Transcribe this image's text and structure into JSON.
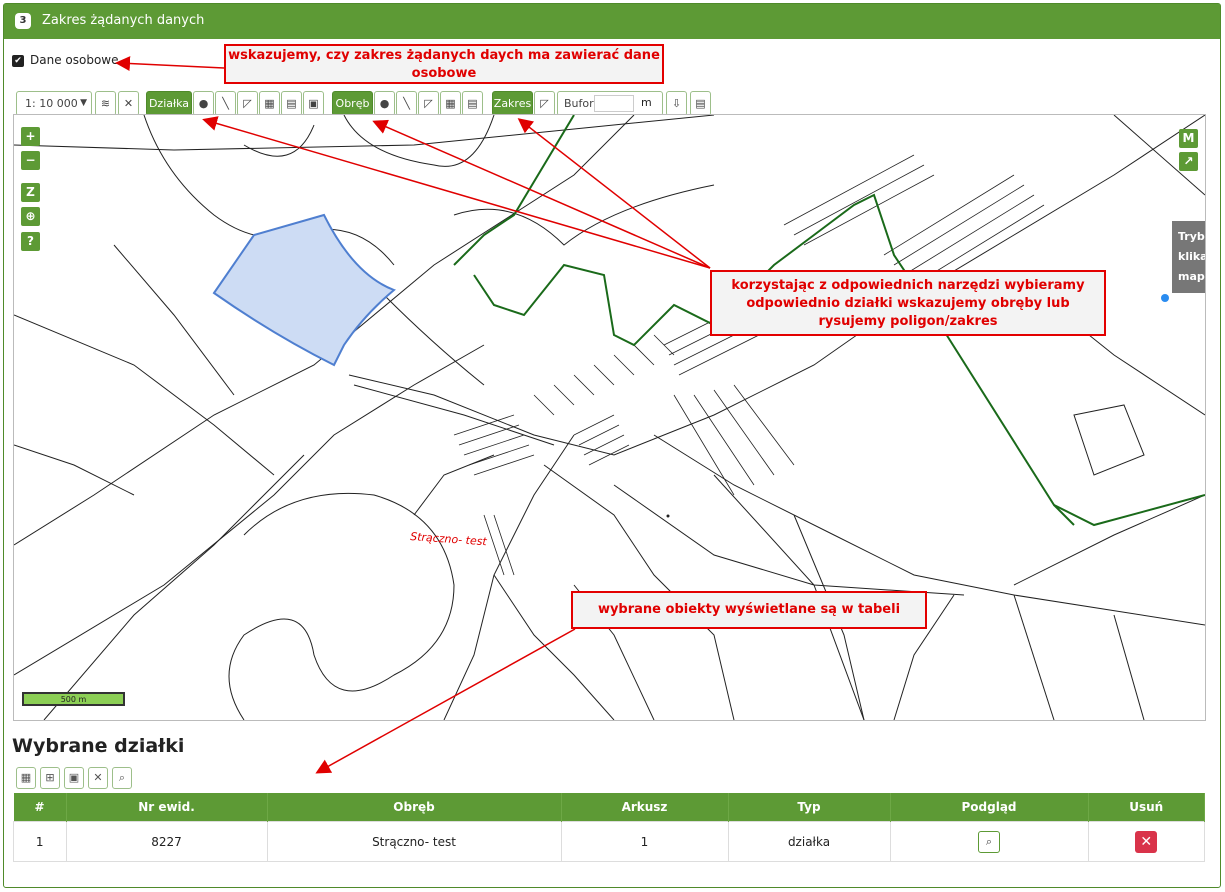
{
  "panel": {
    "step": "3",
    "title": "Zakres żądanych danych"
  },
  "personal_data": {
    "checked": true,
    "label": "Dane osobowe"
  },
  "callouts": {
    "personal": "wskazujemy, czy zakres żądanych daych ma zawierać dane osobowe",
    "tools": "korzystając z odpowiednich narzędzi wybieramy odpowiednio działki wskazujemy obręby lub rysujemy poligon/zakres",
    "table": "wybrane obiekty wyświetlane są w tabeli"
  },
  "toolbar": {
    "scale_value": "1: 10 000",
    "dzialka_label": "Działka",
    "obreb_label": "Obręb",
    "zakres_label": "Zakres",
    "bufor_label": "Bufor:",
    "bufor_value": "",
    "bufor_unit": "m"
  },
  "map": {
    "controls": [
      "+",
      "−",
      "Z",
      "⊕",
      "?"
    ],
    "right_controls": [
      "M",
      "↗"
    ],
    "place_label": "Strączno- test",
    "scale_label": "500 m",
    "mode_tooltip": [
      "Tryb:",
      "klikaj",
      "mapy"
    ],
    "colors": {
      "selection_fill": "#cddcf4",
      "selection_stroke": "#4f7fd0",
      "boundary": "#1a6a1a",
      "label": "#e00000"
    }
  },
  "selected": {
    "title": "Wybrane działki",
    "columns": [
      "#",
      "Nr ewid.",
      "Obręb",
      "Arkusz",
      "Typ",
      "Podgląd",
      "Usuń"
    ],
    "rows": [
      {
        "index": "1",
        "nr": "8227",
        "obreb": "Strączno- test",
        "arkusz": "1",
        "typ": "działka"
      }
    ]
  }
}
